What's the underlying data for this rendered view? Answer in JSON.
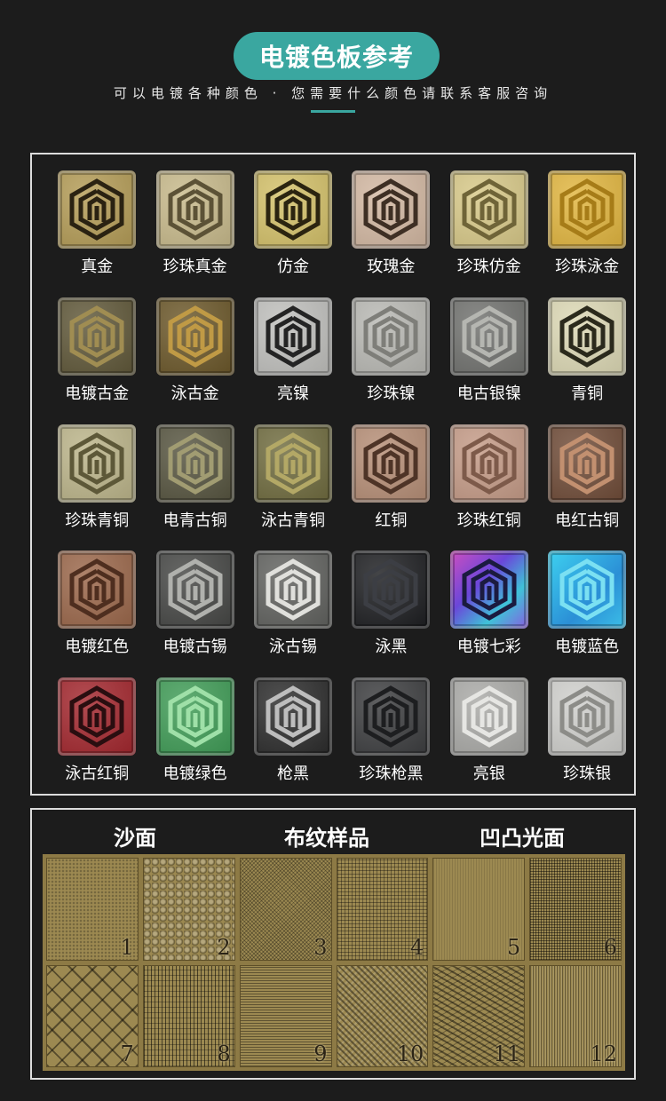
{
  "header": {
    "title": "电镀色板参考",
    "subtitle": "可以电镀各种颜色 · 您需要什么颜色请联系客服咨询"
  },
  "swatches": [
    {
      "label": "真金",
      "bg": "#b39b55",
      "line": "#2a2212"
    },
    {
      "label": "珍珠真金",
      "bg": "#c7b98a",
      "line": "#5c5236"
    },
    {
      "label": "仿金",
      "bg": "#d3c068",
      "line": "#2b2410"
    },
    {
      "label": "玫瑰金",
      "bg": "#d2b7a1",
      "line": "#3e2f24"
    },
    {
      "label": "珍珠仿金",
      "bg": "#d7c887",
      "line": "#6f6438"
    },
    {
      "label": "珍珠泳金",
      "bg": "#e1b53e",
      "line": "#a67c18"
    },
    {
      "label": "电镀古金",
      "bg": "#5e5637",
      "line": "#a08d52"
    },
    {
      "label": "泳古金",
      "bg": "#6a5628",
      "line": "#c09a45"
    },
    {
      "label": "亮镍",
      "bg": "#bfbfbc",
      "line": "#242424"
    },
    {
      "label": "珍珠镍",
      "bg": "#b8b8b3",
      "line": "#7e7e79"
    },
    {
      "label": "电古银镍",
      "bg": "#6f706d",
      "line": "#b5b6b1"
    },
    {
      "label": "青铜",
      "bg": "#dcd8b4",
      "line": "#2b2a1c"
    },
    {
      "label": "珍珠青铜",
      "bg": "#bbb489",
      "line": "#5d5838"
    },
    {
      "label": "电青古铜",
      "bg": "#55533e",
      "line": "#a19c72"
    },
    {
      "label": "泳古青铜",
      "bg": "#6e6a3d",
      "line": "#b3a866"
    },
    {
      "label": "红铜",
      "bg": "#b58d75",
      "line": "#4e3427"
    },
    {
      "label": "珍珠红铜",
      "bg": "#c49a86",
      "line": "#7d5a4a"
    },
    {
      "label": "电红古铜",
      "bg": "#6e4a36",
      "line": "#c29070"
    },
    {
      "label": "电镀红色",
      "bg": "#9a6649",
      "line": "#4e2e1f"
    },
    {
      "label": "电镀古锡",
      "bg": "#444543",
      "line": "#b0b1ad"
    },
    {
      "label": "泳古锡",
      "bg": "#5f605d",
      "line": "#e0e0dc"
    },
    {
      "label": "泳黑",
      "bg": "#1b1c1f",
      "line": "#3c3e44"
    },
    {
      "label": "电镀七彩",
      "bg": "#7e4fc9",
      "line": "#1b1b40"
    },
    {
      "label": "电镀蓝色",
      "bg": "#2fa7d7",
      "line": "#7be0f2"
    },
    {
      "label": "泳古红铜",
      "bg": "#a2252c",
      "line": "#2a0e10"
    },
    {
      "label": "电镀绿色",
      "bg": "#3e9b55",
      "line": "#9fe0a8"
    },
    {
      "label": "枪黑",
      "bg": "#2a2a2a",
      "line": "#bdbdbd"
    },
    {
      "label": "珍珠枪黑",
      "bg": "#3b3c3e",
      "line": "#1d1e20"
    },
    {
      "label": "亮银",
      "bg": "#a9a9a6",
      "line": "#e6e6e3"
    },
    {
      "label": "珍珠银",
      "bg": "#cfcfcc",
      "line": "#8c8c88"
    }
  ],
  "textures": {
    "headings": [
      "沙面",
      "布纹样品",
      "凹凸光面"
    ],
    "samples": [
      {
        "number": "1",
        "pattern": "sand"
      },
      {
        "number": "2",
        "pattern": "pebble"
      },
      {
        "number": "3",
        "pattern": "fine-crosshatch"
      },
      {
        "number": "4",
        "pattern": "grid"
      },
      {
        "number": "5",
        "pattern": "brushed"
      },
      {
        "number": "6",
        "pattern": "mesh"
      },
      {
        "number": "7",
        "pattern": "diamond"
      },
      {
        "number": "8",
        "pattern": "vertical-lines"
      },
      {
        "number": "9",
        "pattern": "horizontal-lines"
      },
      {
        "number": "10",
        "pattern": "weave"
      },
      {
        "number": "11",
        "pattern": "twill"
      },
      {
        "number": "12",
        "pattern": "vertical-brushed"
      }
    ]
  },
  "colors": {
    "accent": "#3aa7a0",
    "texture_base": "#9c8951"
  }
}
